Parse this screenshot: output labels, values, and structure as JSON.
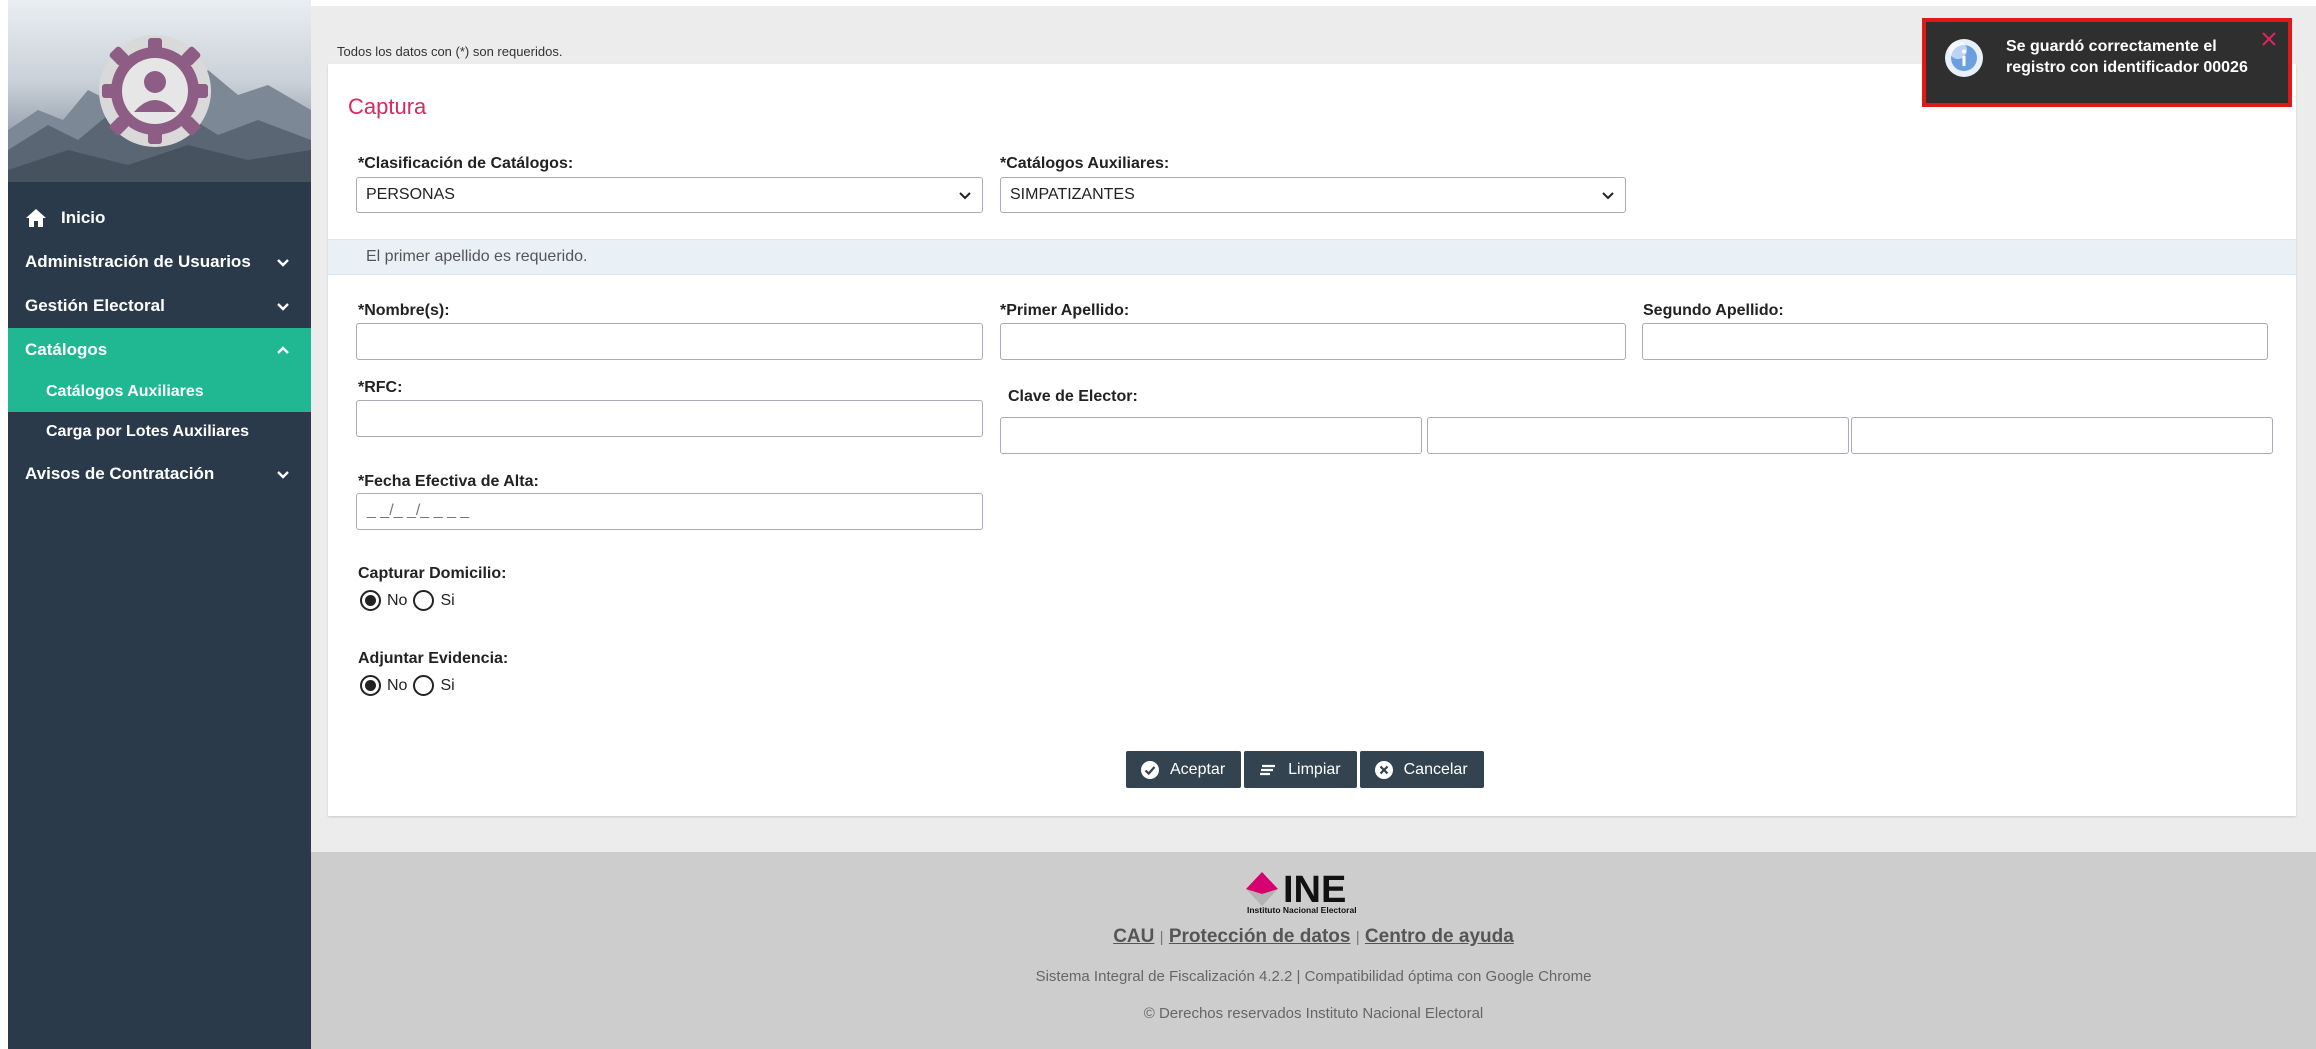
{
  "sidebar": {
    "items": [
      {
        "label": "Inicio"
      },
      {
        "label": "Administración de Usuarios"
      },
      {
        "label": "Gestión Electoral"
      },
      {
        "label": "Catálogos"
      },
      {
        "label": "Catálogos Auxiliares"
      },
      {
        "label": "Carga por Lotes Auxiliares"
      },
      {
        "label": "Avisos de Contratación"
      }
    ]
  },
  "page": {
    "required_note": "Todos los datos con (*) son requeridos.",
    "title": "Captura"
  },
  "form": {
    "clasificacion_label": "*Clasificación de Catálogos:",
    "clasificacion_value": "PERSONAS",
    "catalogos_label": "*Catálogos Auxiliares:",
    "catalogos_value": "SIMPATIZANTES",
    "alert": "El primer apellido es requerido.",
    "nombre_label": "*Nombre(s):",
    "primer_apellido_label": "*Primer Apellido:",
    "segundo_apellido_label": "Segundo Apellido:",
    "rfc_label": "*RFC:",
    "clave_elector_label": "Clave de Elector:",
    "fecha_label": "*Fecha Efectiva de Alta:",
    "fecha_placeholder": "_ _/_ _/_ _ _ _",
    "domicilio_label": "Capturar Domicilio:",
    "evidencia_label": "Adjuntar Evidencia:",
    "opt_no": "No",
    "opt_si": "Si"
  },
  "buttons": {
    "aceptar": "Aceptar",
    "limpiar": "Limpiar",
    "cancelar": "Cancelar"
  },
  "footer": {
    "ine": "INE",
    "ine_sub": "Instituto Nacional Electoral",
    "link_cau": "CAU",
    "link_proteccion": "Protección de datos",
    "link_ayuda": "Centro de ayuda",
    "sep": "|",
    "system": "Sistema Integral de Fiscalización 4.2.2 | Compatibilidad óptima con Google Chrome",
    "copyright": "© Derechos reservados Instituto Nacional Electoral"
  },
  "toast": {
    "message": "Se guardó correctamente el registro con identificador 00026"
  },
  "colors": {
    "sidebar_bg": "#2b3a4a",
    "accent": "#1fb893",
    "title": "#d6295d",
    "ine_pink": "#d6006e",
    "toast_border": "#e01818"
  },
  "icons": [
    "home-icon",
    "chevron-down-icon",
    "chevron-up-icon",
    "check-circle-icon",
    "lines-icon",
    "x-circle-icon",
    "info-icon",
    "close-icon",
    "user-gear-logo"
  ]
}
